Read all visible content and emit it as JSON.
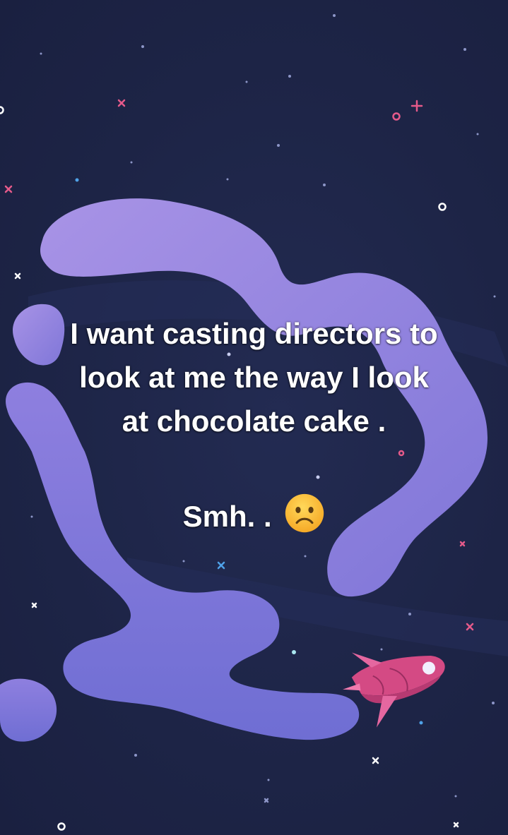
{
  "story": {
    "line1": "I want casting directors to",
    "line2": "look at me the way I look",
    "line3": "at chocolate cake .",
    "line4": "Smh. . ",
    "emoji": "slightly-frowning-face-icon"
  },
  "colors": {
    "background": "#1e2547",
    "cloud": "#9b87e0",
    "cloud_shade": "#7a72d6",
    "rocket": "#e0508a",
    "text": "#ffffff"
  }
}
